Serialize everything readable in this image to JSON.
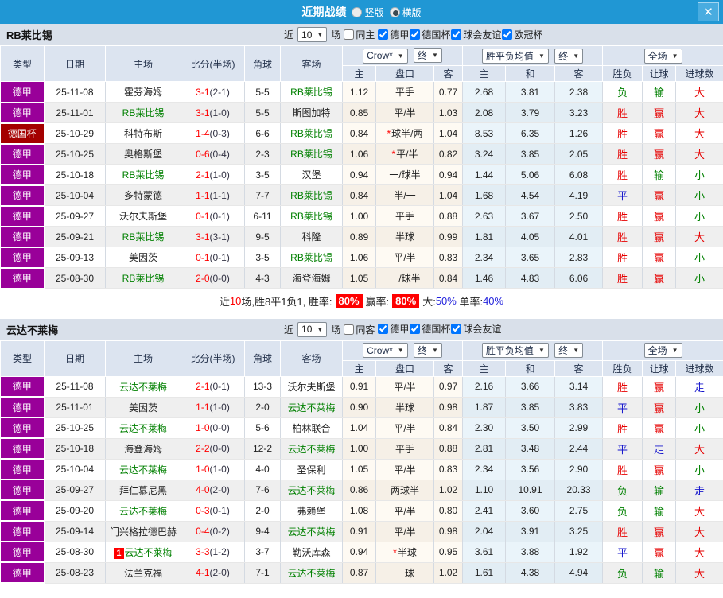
{
  "titlebar": {
    "title": "近期战绩",
    "vertical_label": "竖版",
    "horizontal_label": "横版",
    "close_glyph": "✕"
  },
  "icons": {
    "chevron_down": "▼"
  },
  "columns": {
    "type": "类型",
    "date": "日期",
    "home": "主场",
    "score": "比分(半场)",
    "corner": "角球",
    "away": "客场",
    "sub": {
      "o_home": "主",
      "handicap": "盘口",
      "o_away": "客",
      "avg_home": "主",
      "avg_draw": "和",
      "avg_away": "客",
      "result": "胜负",
      "handicap_result": "让球",
      "goals": "进球数"
    }
  },
  "controls": {
    "company": "Crow*",
    "final": "终",
    "avg": "胜平负均值",
    "full": "全场"
  },
  "colors": {
    "titlebar_bg": "#2097d4",
    "league": {
      "德甲": "#990099",
      "德国杯": "#a40000"
    },
    "result": {
      "胜": "#e60000",
      "赢": "#e60000",
      "大": "#e60000",
      "平": "#1515cc",
      "走": "#1515cc",
      "负": "#008000",
      "输": "#008000",
      "小": "#008000"
    },
    "self_team": "#008000",
    "score": "#ff0000"
  },
  "sections": [
    {
      "team": "RB莱比锡",
      "filter": {
        "near_label": "近",
        "count": "10",
        "games_label": "场",
        "same_label": "同主",
        "same_checked": false,
        "leagues": [
          {
            "label": "德甲",
            "checked": true
          },
          {
            "label": "德国杯",
            "checked": true
          },
          {
            "label": "球会友谊",
            "checked": true
          },
          {
            "label": "欧冠杯",
            "checked": true
          }
        ]
      },
      "rows": [
        {
          "league": "德甲",
          "date": "25-11-08",
          "home": "霍芬海姆",
          "home_self": false,
          "score": "3-1",
          "half": "(2-1)",
          "corners": "5-5",
          "away": "RB莱比锡",
          "away_self": true,
          "odds": [
            "1.12",
            "平手",
            "0.77"
          ],
          "star": false,
          "avg": [
            "2.68",
            "3.81",
            "2.38"
          ],
          "results": [
            "负",
            "输",
            "大"
          ]
        },
        {
          "league": "德甲",
          "date": "25-11-01",
          "home": "RB莱比锡",
          "home_self": true,
          "score": "3-1",
          "half": "(1-0)",
          "corners": "5-5",
          "away": "斯图加特",
          "away_self": false,
          "odds": [
            "0.85",
            "平/半",
            "1.03"
          ],
          "star": false,
          "avg": [
            "2.08",
            "3.79",
            "3.23"
          ],
          "results": [
            "胜",
            "赢",
            "大"
          ]
        },
        {
          "league": "德国杯",
          "date": "25-10-29",
          "home": "科特布斯",
          "home_self": false,
          "score": "1-4",
          "half": "(0-3)",
          "corners": "6-6",
          "away": "RB莱比锡",
          "away_self": true,
          "odds": [
            "0.84",
            "球半/两",
            "1.04"
          ],
          "star": true,
          "avg": [
            "8.53",
            "6.35",
            "1.26"
          ],
          "results": [
            "胜",
            "赢",
            "大"
          ]
        },
        {
          "league": "德甲",
          "date": "25-10-25",
          "home": "奥格斯堡",
          "home_self": false,
          "score": "0-6",
          "half": "(0-4)",
          "corners": "2-3",
          "away": "RB莱比锡",
          "away_self": true,
          "odds": [
            "1.06",
            "平/半",
            "0.82"
          ],
          "star": true,
          "avg": [
            "3.24",
            "3.85",
            "2.05"
          ],
          "results": [
            "胜",
            "赢",
            "大"
          ]
        },
        {
          "league": "德甲",
          "date": "25-10-18",
          "home": "RB莱比锡",
          "home_self": true,
          "score": "2-1",
          "half": "(1-0)",
          "corners": "3-5",
          "away": "汉堡",
          "away_self": false,
          "odds": [
            "0.94",
            "一/球半",
            "0.94"
          ],
          "star": false,
          "avg": [
            "1.44",
            "5.06",
            "6.08"
          ],
          "results": [
            "胜",
            "输",
            "小"
          ]
        },
        {
          "league": "德甲",
          "date": "25-10-04",
          "home": "多特蒙德",
          "home_self": false,
          "score": "1-1",
          "half": "(1-1)",
          "corners": "7-7",
          "away": "RB莱比锡",
          "away_self": true,
          "odds": [
            "0.84",
            "半/一",
            "1.04"
          ],
          "star": false,
          "avg": [
            "1.68",
            "4.54",
            "4.19"
          ],
          "results": [
            "平",
            "赢",
            "小"
          ]
        },
        {
          "league": "德甲",
          "date": "25-09-27",
          "home": "沃尔夫斯堡",
          "home_self": false,
          "score": "0-1",
          "half": "(0-1)",
          "corners": "6-11",
          "away": "RB莱比锡",
          "away_self": true,
          "odds": [
            "1.00",
            "平手",
            "0.88"
          ],
          "star": false,
          "avg": [
            "2.63",
            "3.67",
            "2.50"
          ],
          "results": [
            "胜",
            "赢",
            "小"
          ]
        },
        {
          "league": "德甲",
          "date": "25-09-21",
          "home": "RB莱比锡",
          "home_self": true,
          "score": "3-1",
          "half": "(3-1)",
          "corners": "9-5",
          "away": "科隆",
          "away_self": false,
          "odds": [
            "0.89",
            "半球",
            "0.99"
          ],
          "star": false,
          "avg": [
            "1.81",
            "4.05",
            "4.01"
          ],
          "results": [
            "胜",
            "赢",
            "大"
          ]
        },
        {
          "league": "德甲",
          "date": "25-09-13",
          "home": "美因茨",
          "home_self": false,
          "score": "0-1",
          "half": "(0-1)",
          "corners": "3-5",
          "away": "RB莱比锡",
          "away_self": true,
          "odds": [
            "1.06",
            "平/半",
            "0.83"
          ],
          "star": false,
          "avg": [
            "2.34",
            "3.65",
            "2.83"
          ],
          "results": [
            "胜",
            "赢",
            "小"
          ]
        },
        {
          "league": "德甲",
          "date": "25-08-30",
          "home": "RB莱比锡",
          "home_self": true,
          "score": "2-0",
          "half": "(0-0)",
          "corners": "4-3",
          "away": "海登海姆",
          "away_self": false,
          "odds": [
            "1.05",
            "一/球半",
            "0.84"
          ],
          "star": false,
          "avg": [
            "1.46",
            "4.83",
            "6.06"
          ],
          "results": [
            "胜",
            "赢",
            "小"
          ]
        }
      ],
      "summary": [
        {
          "text": "近",
          "style": "plain"
        },
        {
          "text": "10",
          "style": "red"
        },
        {
          "text": "场,胜8平1负1, 胜率:",
          "style": "plain"
        },
        {
          "text": "80%",
          "style": "badge"
        },
        {
          "text": "赢率:",
          "style": "plain"
        },
        {
          "text": "80%",
          "style": "badge"
        },
        {
          "text": "大:",
          "style": "plain"
        },
        {
          "text": "50%",
          "style": "blue"
        },
        {
          "text": " 单率:",
          "style": "plain"
        },
        {
          "text": "40%",
          "style": "blue"
        }
      ]
    },
    {
      "team": "云达不莱梅",
      "filter": {
        "near_label": "近",
        "count": "10",
        "games_label": "场",
        "same_label": "同客",
        "same_checked": false,
        "leagues": [
          {
            "label": "德甲",
            "checked": true
          },
          {
            "label": "德国杯",
            "checked": true
          },
          {
            "label": "球会友谊",
            "checked": true
          }
        ]
      },
      "rows": [
        {
          "league": "德甲",
          "date": "25-11-08",
          "home": "云达不莱梅",
          "home_self": true,
          "score": "2-1",
          "half": "(0-1)",
          "corners": "13-3",
          "away": "沃尔夫斯堡",
          "away_self": false,
          "odds": [
            "0.91",
            "平/半",
            "0.97"
          ],
          "star": false,
          "avg": [
            "2.16",
            "3.66",
            "3.14"
          ],
          "results": [
            "胜",
            "赢",
            "走"
          ]
        },
        {
          "league": "德甲",
          "date": "25-11-01",
          "home": "美因茨",
          "home_self": false,
          "score": "1-1",
          "half": "(1-0)",
          "corners": "2-0",
          "away": "云达不莱梅",
          "away_self": true,
          "odds": [
            "0.90",
            "半球",
            "0.98"
          ],
          "star": false,
          "avg": [
            "1.87",
            "3.85",
            "3.83"
          ],
          "results": [
            "平",
            "赢",
            "小"
          ]
        },
        {
          "league": "德甲",
          "date": "25-10-25",
          "home": "云达不莱梅",
          "home_self": true,
          "score": "1-0",
          "half": "(0-0)",
          "corners": "5-6",
          "away": "柏林联合",
          "away_self": false,
          "odds": [
            "1.04",
            "平/半",
            "0.84"
          ],
          "star": false,
          "avg": [
            "2.30",
            "3.50",
            "2.99"
          ],
          "results": [
            "胜",
            "赢",
            "小"
          ]
        },
        {
          "league": "德甲",
          "date": "25-10-18",
          "home": "海登海姆",
          "home_self": false,
          "score": "2-2",
          "half": "(0-0)",
          "corners": "12-2",
          "away": "云达不莱梅",
          "away_self": true,
          "odds": [
            "1.00",
            "平手",
            "0.88"
          ],
          "star": false,
          "avg": [
            "2.81",
            "3.48",
            "2.44"
          ],
          "results": [
            "平",
            "走",
            "大"
          ]
        },
        {
          "league": "德甲",
          "date": "25-10-04",
          "home": "云达不莱梅",
          "home_self": true,
          "score": "1-0",
          "half": "(1-0)",
          "corners": "4-0",
          "away": "圣保利",
          "away_self": false,
          "odds": [
            "1.05",
            "平/半",
            "0.83"
          ],
          "star": false,
          "avg": [
            "2.34",
            "3.56",
            "2.90"
          ],
          "results": [
            "胜",
            "赢",
            "小"
          ]
        },
        {
          "league": "德甲",
          "date": "25-09-27",
          "home": "拜仁慕尼黑",
          "home_self": false,
          "score": "4-0",
          "half": "(2-0)",
          "corners": "7-6",
          "away": "云达不莱梅",
          "away_self": true,
          "odds": [
            "0.86",
            "两球半",
            "1.02"
          ],
          "star": false,
          "avg": [
            "1.10",
            "10.91",
            "20.33"
          ],
          "results": [
            "负",
            "输",
            "走"
          ]
        },
        {
          "league": "德甲",
          "date": "25-09-20",
          "home": "云达不莱梅",
          "home_self": true,
          "score": "0-3",
          "half": "(0-1)",
          "corners": "2-0",
          "away": "弗赖堡",
          "away_self": false,
          "odds": [
            "1.08",
            "平/半",
            "0.80"
          ],
          "star": false,
          "avg": [
            "2.41",
            "3.60",
            "2.75"
          ],
          "results": [
            "负",
            "输",
            "大"
          ]
        },
        {
          "league": "德甲",
          "date": "25-09-14",
          "home": "门兴格拉德巴赫",
          "home_self": false,
          "score": "0-4",
          "half": "(0-2)",
          "corners": "9-4",
          "away": "云达不莱梅",
          "away_self": true,
          "odds": [
            "0.91",
            "平/半",
            "0.98"
          ],
          "star": false,
          "avg": [
            "2.04",
            "3.91",
            "3.25"
          ],
          "results": [
            "胜",
            "赢",
            "大"
          ]
        },
        {
          "league": "德甲",
          "date": "25-08-30",
          "home": "云达不莱梅",
          "home_self": true,
          "badge": "1",
          "score": "3-3",
          "half": "(1-2)",
          "corners": "3-7",
          "away": "勒沃库森",
          "away_self": false,
          "odds": [
            "0.94",
            "半球",
            "0.95"
          ],
          "star": true,
          "avg": [
            "3.61",
            "3.88",
            "1.92"
          ],
          "results": [
            "平",
            "赢",
            "大"
          ]
        },
        {
          "league": "德甲",
          "date": "25-08-23",
          "home": "法兰克福",
          "home_self": false,
          "score": "4-1",
          "half": "(2-0)",
          "corners": "7-1",
          "away": "云达不莱梅",
          "away_self": true,
          "odds": [
            "0.87",
            "一球",
            "1.02"
          ],
          "star": false,
          "avg": [
            "1.61",
            "4.38",
            "4.94"
          ],
          "results": [
            "负",
            "输",
            "大"
          ]
        }
      ]
    }
  ]
}
